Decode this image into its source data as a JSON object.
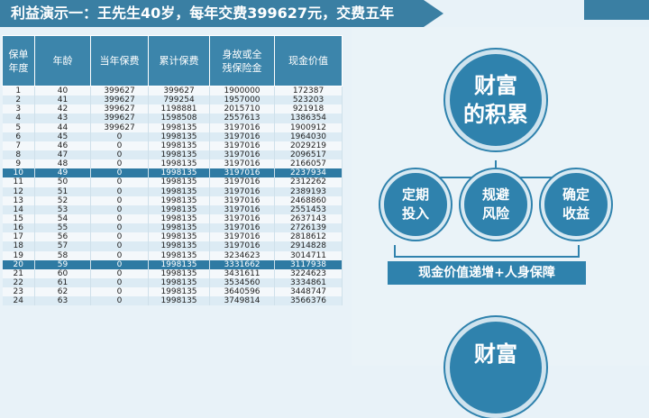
{
  "title": "利益演示一：王先生40岁，每年交费399627元，交费五年",
  "table": {
    "headers": [
      [
        "保单",
        "年度"
      ],
      [
        "年龄"
      ],
      [
        "当年保费"
      ],
      [
        "累计保费"
      ],
      [
        "身故或全",
        "残保险金"
      ],
      [
        "现金价值"
      ]
    ],
    "rows": [
      [
        "1",
        "40",
        "399627",
        "399627",
        "1900000",
        "172387"
      ],
      [
        "2",
        "41",
        "399627",
        "799254",
        "1957000",
        "523203"
      ],
      [
        "3",
        "42",
        "399627",
        "1198881",
        "2015710",
        "921918"
      ],
      [
        "4",
        "43",
        "399627",
        "1598508",
        "2557613",
        "1386354"
      ],
      [
        "5",
        "44",
        "399627",
        "1998135",
        "3197016",
        "1900912"
      ],
      [
        "6",
        "45",
        "0",
        "1998135",
        "3197016",
        "1964030"
      ],
      [
        "7",
        "46",
        "0",
        "1998135",
        "3197016",
        "2029219"
      ],
      [
        "8",
        "47",
        "0",
        "1998135",
        "3197016",
        "2096517"
      ],
      [
        "9",
        "48",
        "0",
        "1998135",
        "3197016",
        "2166057"
      ],
      [
        "10",
        "49",
        "0",
        "1998135",
        "3197016",
        "2237934"
      ],
      [
        "11",
        "50",
        "0",
        "1998135",
        "3197016",
        "2312262"
      ],
      [
        "12",
        "51",
        "0",
        "1998135",
        "3197016",
        "2389193"
      ],
      [
        "13",
        "52",
        "0",
        "1998135",
        "3197016",
        "2468860"
      ],
      [
        "14",
        "53",
        "0",
        "1998135",
        "3197016",
        "2551453"
      ],
      [
        "15",
        "54",
        "0",
        "1998135",
        "3197016",
        "2637143"
      ],
      [
        "16",
        "55",
        "0",
        "1998135",
        "3197016",
        "2726139"
      ],
      [
        "17",
        "56",
        "0",
        "1998135",
        "3197016",
        "2818612"
      ],
      [
        "18",
        "57",
        "0",
        "1998135",
        "3197016",
        "2914828"
      ],
      [
        "19",
        "58",
        "0",
        "1998135",
        "3234623",
        "3014711"
      ],
      [
        "20",
        "59",
        "0",
        "1998135",
        "3331662",
        "3117938"
      ],
      [
        "21",
        "60",
        "0",
        "1998135",
        "3431611",
        "3224623"
      ],
      [
        "22",
        "61",
        "0",
        "1998135",
        "3534560",
        "3334861"
      ],
      [
        "23",
        "62",
        "0",
        "1998135",
        "3640596",
        "3448747"
      ],
      [
        "24",
        "63",
        "0",
        "1998135",
        "3749814",
        "3566376"
      ]
    ],
    "highlight_rows": [
      10,
      20
    ]
  },
  "diagram": {
    "top_circle": [
      "财富",
      "的积累"
    ],
    "small_circles": [
      [
        "定期",
        "投入"
      ],
      [
        "规避",
        "风险"
      ],
      [
        "确定",
        "收益"
      ]
    ],
    "bar_text": "现金价值递增+人身保障",
    "bottom_circle": [
      "财富"
    ]
  },
  "colors": {
    "primary": "#2f82ad",
    "header": "#3c85ab",
    "highlight": "#2e7aa3"
  }
}
